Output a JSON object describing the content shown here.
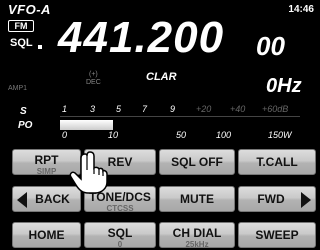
{
  "status": {
    "vfo": "VFO-A",
    "clock": "14:46",
    "mode": "FM",
    "sql_label": "SQL"
  },
  "frequency": {
    "main": "441.200",
    "small": "00"
  },
  "indicators": {
    "amp": "AMP1",
    "plus_minus": "(+)",
    "dec": "DEC",
    "clar": "CLAR",
    "offset": "0Hz"
  },
  "meter": {
    "s_label": "S",
    "po_label": "PO",
    "s_ticks": [
      "1",
      "3",
      "5",
      "7",
      "9",
      "+20",
      "+40",
      "+60dB"
    ],
    "po_ticks": [
      "0",
      "10",
      "50",
      "100",
      "150W"
    ],
    "po_level": 0.22
  },
  "buttons": {
    "row1": [
      {
        "main": "RPT",
        "sub": "SIMP"
      },
      {
        "main": "REV",
        "sub": ""
      },
      {
        "main": "SQL OFF",
        "sub": ""
      },
      {
        "main": "T.CALL",
        "sub": ""
      }
    ],
    "row2": [
      {
        "main": "BACK",
        "sub": ""
      },
      {
        "main": "TONE/DCS",
        "sub": "CTCSS"
      },
      {
        "main": "MUTE",
        "sub": ""
      },
      {
        "main": "FWD",
        "sub": ""
      }
    ],
    "row3": [
      {
        "main": "HOME",
        "sub": ""
      },
      {
        "main": "SQL",
        "sub": "0"
      },
      {
        "main": "CH DIAL",
        "sub": "25kHz"
      },
      {
        "main": "SWEEP",
        "sub": ""
      }
    ]
  },
  "icons": {
    "touch": "hand-pointer-icon"
  }
}
